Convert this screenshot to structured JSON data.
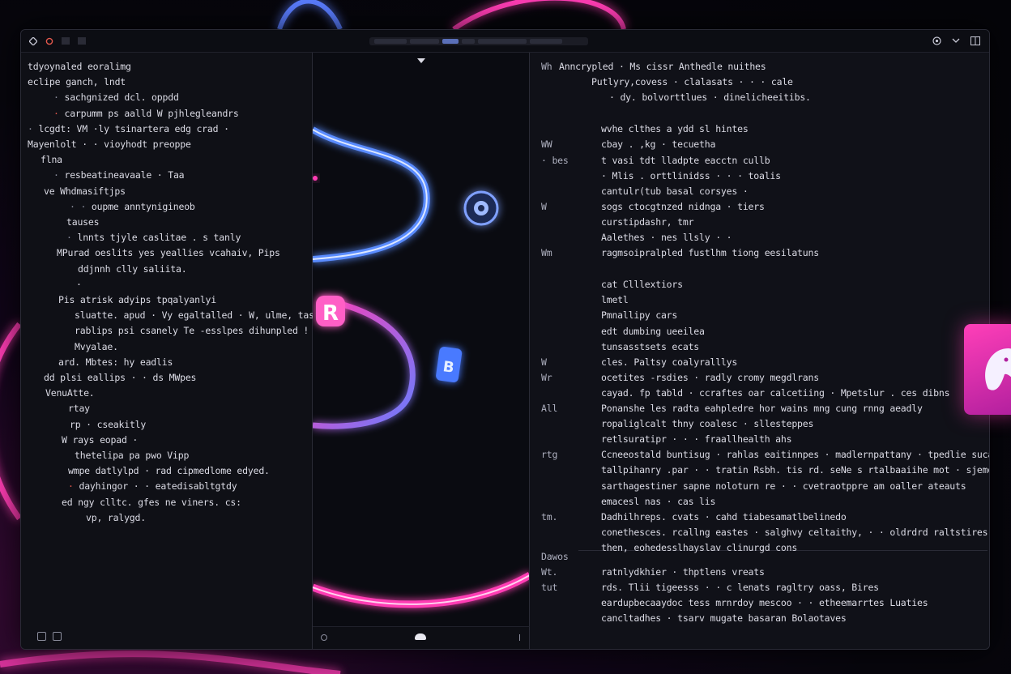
{
  "titlebar": {
    "left_icons": [
      "diamond-icon",
      "record-icon",
      "square-icon",
      "square-icon"
    ],
    "right_icons": [
      "target-icon",
      "chevron-down-icon",
      "split-icon"
    ]
  },
  "left_pane": {
    "lines": [
      {
        "indent": 8,
        "text": "tdyoynaled eoralimg"
      },
      {
        "indent": 8,
        "text": "eclipe  ganch, lndt"
      },
      {
        "indent": 40,
        "bullet": "·",
        "text": "sachgnized dcl. oppdd"
      },
      {
        "indent": 40,
        "bullet": "·",
        "red": true,
        "text": "carpumm ps  aalld W pjhlegleandrs"
      },
      {
        "indent": 8,
        "bullet": "·",
        "text": "lcgdt: VM ·ly  tsinartera edg  crad   ·"
      },
      {
        "indent": 8,
        "text": "Mayenlolt  ·   ·   vioyhodt  preoppe"
      },
      {
        "indent": 24,
        "text": "flna"
      },
      {
        "indent": 40,
        "bullet": "·",
        "text": "resbeatineavaale  ·  Taa"
      },
      {
        "indent": 28,
        "text": "ve Whdmasiftjps"
      },
      {
        "indent": 60,
        "bullet": "·  ·",
        "text": "oupme  anntynigineob"
      },
      {
        "indent": 56,
        "text": "tauses"
      },
      {
        "indent": 56,
        "bullet": "·",
        "text": "lnnts tjyle  caslitae  . s tanly"
      },
      {
        "indent": 44,
        "text": "MPurad oeslits yes yeallies  vcahaiv, Pips"
      },
      {
        "indent": 70,
        "text": "ddjnnh  clly saliita."
      },
      {
        "indent": 68,
        "text": "·"
      },
      {
        "indent": 46,
        "text": "Pis atrisk adyips tpqalyanlyi"
      },
      {
        "indent": 66,
        "text": "sluatte. apud  ·  Vy  egaltalled  ·  W, ulme, tasijjlak"
      },
      {
        "indent": 66,
        "text": "rablips  psi  csanely    Te  -esslpes  dihunpled  !"
      },
      {
        "indent": 66,
        "text": "Mvyalae."
      },
      {
        "indent": 46,
        "text": "ard. Mbtes: hy eadlis"
      },
      {
        "indent": 28,
        "text": "dd plsi  eallips   ·   ·   ds MWpes"
      },
      {
        "indent": 30,
        "text": "VenuAtte."
      },
      {
        "indent": 58,
        "text": "rtay"
      },
      {
        "indent": 60,
        "text": "rp  ·  cseakitly"
      },
      {
        "indent": 50,
        "text": "W  rays  eopad   ·"
      },
      {
        "indent": 66,
        "text": "thetelipa pa  pwo Vipp"
      },
      {
        "indent": 58,
        "text": "wmpe datlylpd  ·  rad cipmedlome  edyed."
      },
      {
        "indent": 58,
        "bullet": "·",
        "red": true,
        "text": "dayhingor  ·   ·   eatedisabltgtdy"
      },
      {
        "indent": 50,
        "text": "ed  ngy clltc. gfes  ne  viners.  cs:"
      },
      {
        "indent": 80,
        "text": "vp,  ralygd."
      }
    ]
  },
  "right_pane": {
    "lines": [
      {
        "lab": "Wh",
        "indent": 0,
        "text": "Anncrypled   ·   Ms  cissr  Anthedle  nuithes"
      },
      {
        "lab": "",
        "indent": 40,
        "text": "Putlyry,covess   ·   clalasats  ·  ·  ·  cale"
      },
      {
        "lab": "",
        "indent": 62,
        "text": "·  dy. bolvorttlues   ·   dinelicheeitibs."
      },
      {
        "lab": "",
        "indent": 52,
        "text": "wvhe  clthes a ydd  sl  hintes"
      },
      {
        "lab": "WW",
        "indent": 52,
        "text": "cbay . ,kg   ·   tecuetha"
      },
      {
        "lab": "·  bes",
        "indent": 52,
        "text": "t vasi  tdt lladpte  eacctn  cullb"
      },
      {
        "lab": "",
        "indent": 52,
        "text": "·  Mlis . orttlinidss   ·   ·   ·   toalis"
      },
      {
        "lab": "",
        "indent": 52,
        "text": "cantulr(tub  basal corsyes   ·"
      },
      {
        "lab": "W",
        "indent": 52,
        "text": "sogs ctocgtnzed nidnga   ·   tiers"
      },
      {
        "lab": "",
        "indent": 52,
        "text": "curstipdashr,  tmr"
      },
      {
        "lab": "",
        "indent": 52,
        "text": "Aalethes   ·   nes llsly   ·   ·"
      },
      {
        "lab": "Wm",
        "indent": 52,
        "text": "ragmsoipralpled  fustlhm  tiong  eesilatuns"
      },
      {
        "lab": "",
        "indent": 52,
        "text": "cat  Clllextiors"
      },
      {
        "lab": "",
        "indent": 52,
        "text": "lmetl"
      },
      {
        "lab": "",
        "indent": 52,
        "text": "Pmnallipy  cars"
      },
      {
        "lab": "",
        "indent": 52,
        "text": "edt  dumbing  ueeilea"
      },
      {
        "lab": "",
        "indent": 52,
        "text": "tunsasstsets  ecats"
      },
      {
        "lab": "W",
        "indent": 52,
        "text": "cles.  Paltsy coalyralllys"
      },
      {
        "lab": "Wr",
        "indent": 52,
        "text": "ocetites  -rsdies   ·  radly  cromy  megdlrans"
      },
      {
        "lab": "",
        "indent": 52,
        "text": "cayad.  fp tabld   ·   ccraftes   oar  calcetiing   ·   Mpetslur  .  ces  dibns"
      },
      {
        "lab": "All",
        "indent": 52,
        "text": "Ponanshe les  radta  eahpledre hor  wains  mng  cung  rnng  aeadly"
      },
      {
        "lab": "",
        "indent": 52,
        "text": "ropaliglcalt  thny  coalesc  ·  sllesteppes"
      },
      {
        "lab": "",
        "indent": 52,
        "text": "retlsuratipr  ·   ·   ·   fraallhealth  ahs"
      },
      {
        "lab": "rtg",
        "indent": 52,
        "text": "Ccneeostald  buntisug    ·   rahlas  eaitinnpes    ·   madlernpattany   ·   tpedlie  sucas"
      },
      {
        "lab": "",
        "indent": 52,
        "text": "tallpihanry .par  ·  ·  tratin  Rsbh.  tis  rd. seNe s  rtalbaaiihe  mot  ·   sjemd  oltre  itie  agivy  d  ouns"
      },
      {
        "lab": "",
        "indent": 52,
        "text": "sarthagestiner  sapne  noloturn  re   ·   ·   cvetraotppre  am  oaller ateauts"
      },
      {
        "lab": "",
        "indent": 52,
        "text": "emacesl nas   ·   cas  lis"
      },
      {
        "lab": "tm.",
        "indent": 52,
        "text": "Dadhilhreps.  cvats   ·   cahd  tiabesamatlbelinedo"
      },
      {
        "lab": "",
        "indent": 52,
        "text": "conethesces.  rcallng  eastes   ·   salghvy  celtaithy,   ·   ·   oldrdrd  raltstires  cals   ·   ssuv  cuntlies"
      },
      {
        "lab": "",
        "indent": 52,
        "text": "then,  eohedesslhayslav  clinurgd  cons"
      },
      {
        "lab": "Dawos",
        "indent": 0,
        "text": ""
      },
      {
        "lab": "Wt.",
        "indent": 52,
        "text": "ratnlydkhier    ·   thptlens  vreats"
      },
      {
        "lab": "tut",
        "indent": 52,
        "text": "rds. Tlii  tigeesss   ·   ·   c lenats  ragltry  oass,     Bires"
      },
      {
        "lab": "",
        "indent": 52,
        "text": "eardupbecaaydoc    tess  mrnrdoy  mescoo   ·   ·   etheemarrtes        Luaties"
      },
      {
        "lab": "",
        "indent": 52,
        "text": "cancltadhes    ·   tsarv  mugate  basaran  Bolaotaves"
      }
    ]
  },
  "mid_pane": {
    "badges": [
      {
        "name": "pink-badge",
        "glyph": "R"
      },
      {
        "name": "blue-badge",
        "glyph": "B"
      }
    ]
  },
  "colors": {
    "accent_pink": "#ff3db4",
    "accent_blue": "#4a8cff",
    "bullet_red": "#e4584d"
  }
}
